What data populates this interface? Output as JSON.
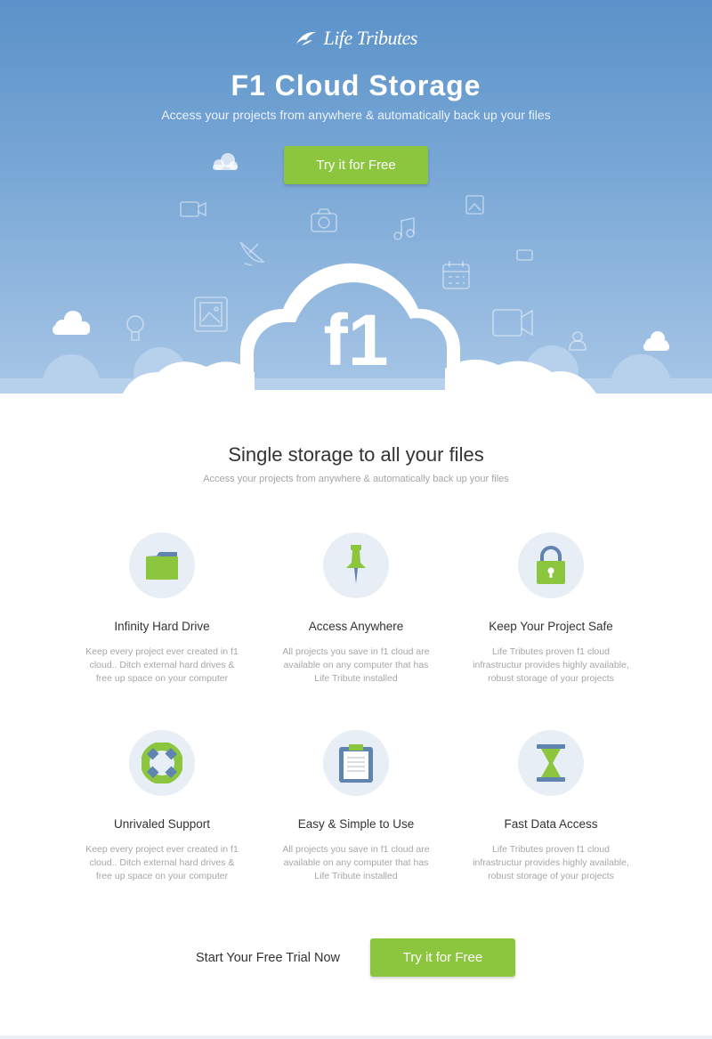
{
  "brand": {
    "logo_text": "Life Tributes"
  },
  "hero": {
    "title": "F1 Cloud Storage",
    "subtitle": "Access your projects from anywhere & automatically back up your files",
    "cta_label": "Try it for Free",
    "cloud_text": "f1"
  },
  "section": {
    "title": "Single storage to all your files",
    "subtitle": "Access your projects from anywhere & automatically back up your files"
  },
  "features": [
    {
      "icon": "folder-icon",
      "title": "Infinity Hard Drive",
      "description": "Keep every project ever created in f1 cloud.. Ditch external hard drives & free up space on your computer"
    },
    {
      "icon": "pushpin-icon",
      "title": "Access Anywhere",
      "description": "All projects you save in f1 cloud are available on any computer that has Life Tribute installed"
    },
    {
      "icon": "padlock-icon",
      "title": "Keep Your Project Safe",
      "description": "Life Tributes proven f1 cloud infrastructur provides highly available, robust storage of your projects"
    },
    {
      "icon": "lifebuoy-icon",
      "title": "Unrivaled Support",
      "description": "Keep every project ever created in f1 cloud.. Ditch external hard drives & free up space on your computer"
    },
    {
      "icon": "clipboard-icon",
      "title": "Easy & Simple to Use",
      "description": "All projects you save in f1 cloud are available on any computer that has Life Tribute installed"
    },
    {
      "icon": "hourglass-icon",
      "title": "Fast Data Access",
      "description": "Life Tributes proven f1 cloud infrastructur provides highly available, robust storage of your projects"
    }
  ],
  "cta": {
    "label": "Start Your Free Trial Now",
    "button_label": "Try it for Free"
  },
  "colors": {
    "accent": "#8cc63f",
    "hero_top": "#5b92c9",
    "hero_bottom": "#a7c6e6",
    "icon_circle": "#e8eef6",
    "icon_blue": "#5f84b0"
  }
}
